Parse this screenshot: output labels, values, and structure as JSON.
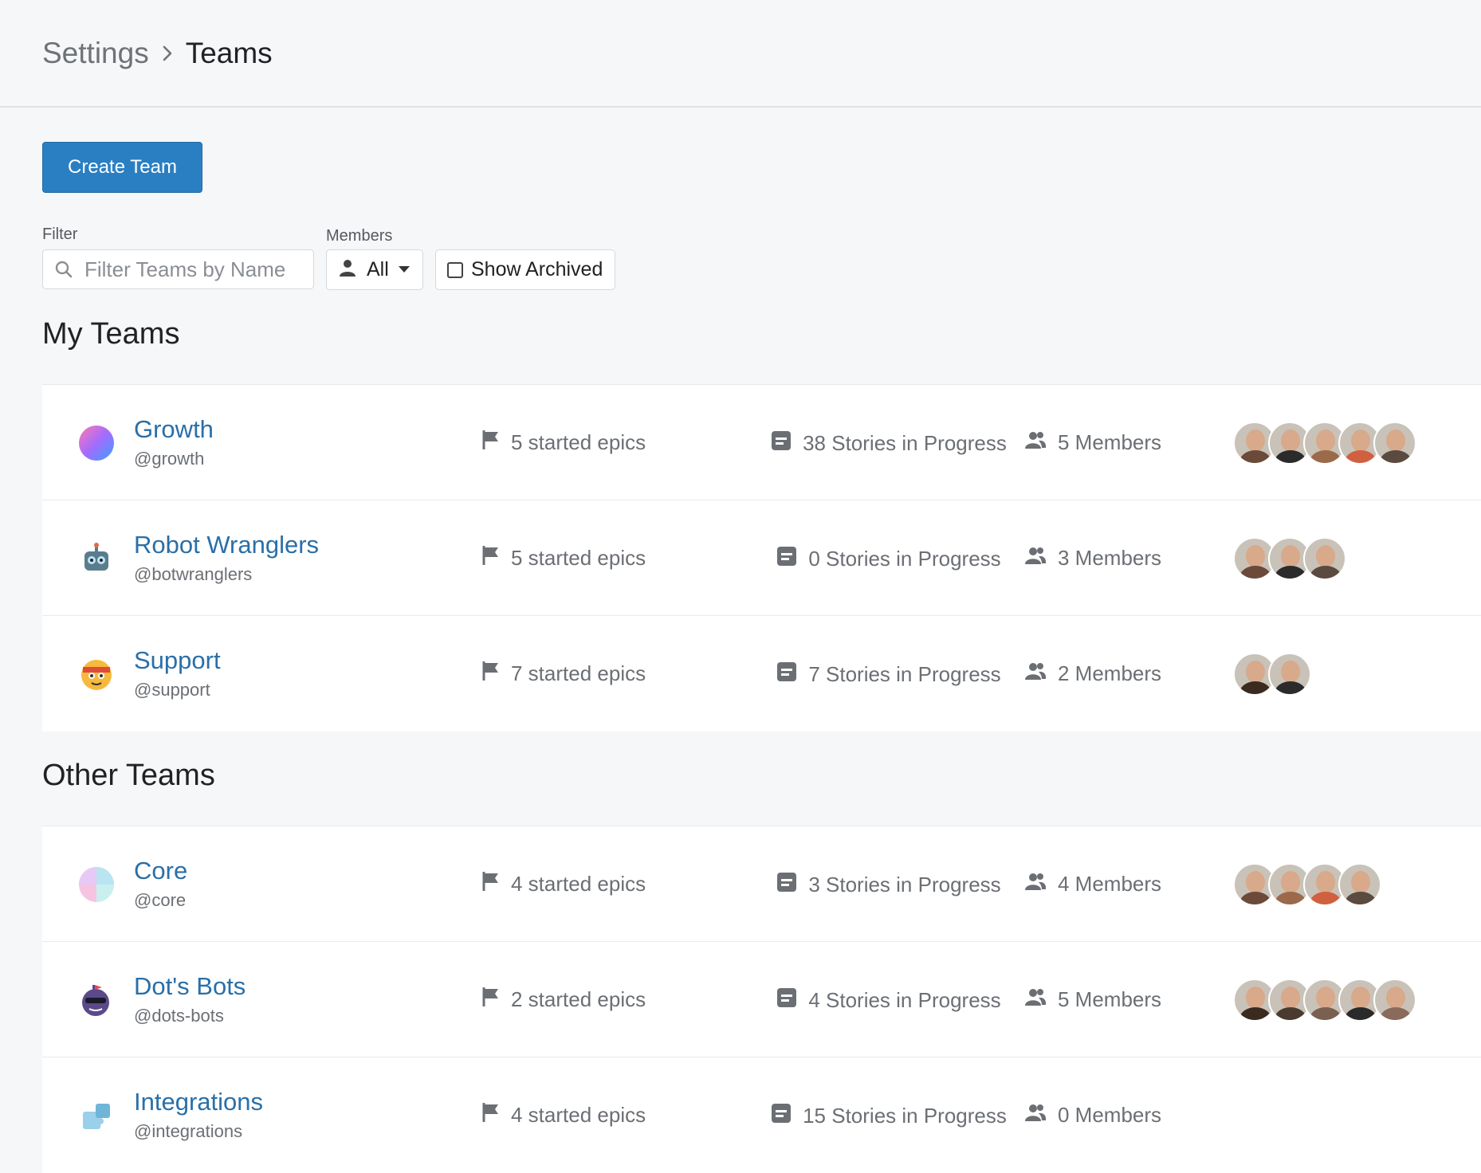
{
  "breadcrumb": {
    "parent": "Settings",
    "current": "Teams"
  },
  "actions": {
    "create_team": "Create Team"
  },
  "filters": {
    "filter_label": "Filter",
    "filter_placeholder": "Filter Teams by Name",
    "members_label": "Members",
    "members_value": "All",
    "show_archived": "Show Archived",
    "show_archived_checked": false
  },
  "sections": {
    "my_teams_title": "My Teams",
    "other_teams_title": "Other Teams"
  },
  "my_teams": [
    {
      "name": "Growth",
      "handle": "@growth",
      "epics": "5 started epics",
      "stories": "38 Stories in Progress",
      "members": "5 Members",
      "avatar_icon": "gradient-orb-icon",
      "member_avatars": [
        "#6b4a3a",
        "#2b2b2b",
        "#9a6a4a",
        "#d06040",
        "#5a4a40"
      ]
    },
    {
      "name": "Robot Wranglers",
      "handle": "@botwranglers",
      "epics": "5 started epics",
      "stories": "0 Stories in Progress",
      "members": "3 Members",
      "avatar_icon": "robot-icon",
      "member_avatars": [
        "#6b4a3a",
        "#2b2b2b",
        "#5a4a40"
      ]
    },
    {
      "name": "Support",
      "handle": "@support",
      "epics": "7 started epics",
      "stories": "7 Stories in Progress",
      "members": "2 Members",
      "avatar_icon": "support-mascot-icon",
      "member_avatars": [
        "#3a2a20",
        "#2b2b2b"
      ]
    }
  ],
  "other_teams": [
    {
      "name": "Core",
      "handle": "@core",
      "epics": "4 started epics",
      "stories": "3 Stories in Progress",
      "members": "4 Members",
      "avatar_icon": "pastel-orb-icon",
      "member_avatars": [
        "#6b4a3a",
        "#9a6a4a",
        "#d06040",
        "#5a4a40"
      ]
    },
    {
      "name": "Dot's Bots",
      "handle": "@dots-bots",
      "epics": "2 started epics",
      "stories": "4 Stories in Progress",
      "members": "5 Members",
      "avatar_icon": "bot-sunglasses-icon",
      "member_avatars": [
        "#3a2a20",
        "#4a3a30",
        "#7a6050",
        "#2a2a2a",
        "#8a6a5a"
      ]
    },
    {
      "name": "Integrations",
      "handle": "@integrations",
      "epics": "4 started epics",
      "stories": "15 Stories in Progress",
      "members": "0 Members",
      "avatar_icon": "puzzle-icon",
      "member_avatars": []
    }
  ]
}
